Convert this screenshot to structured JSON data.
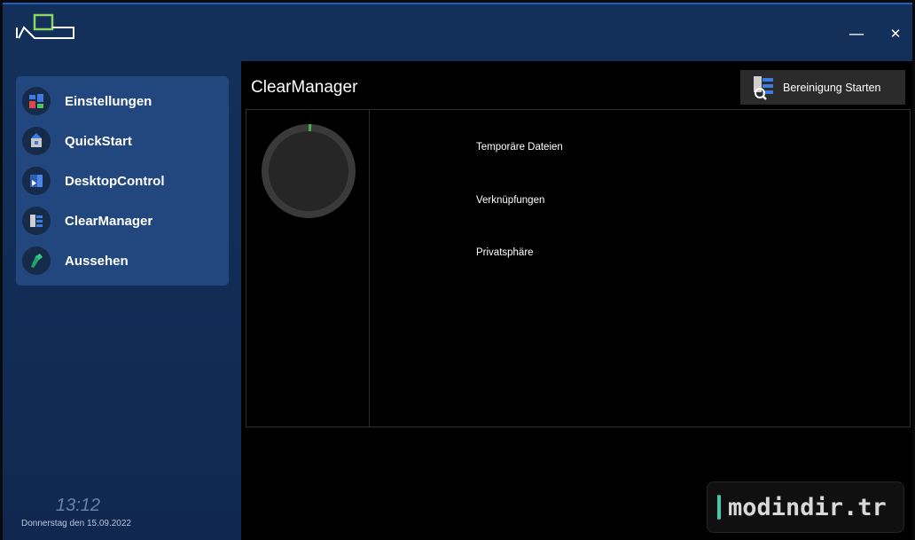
{
  "window": {
    "minimize_glyph": "—",
    "close_glyph": "✕"
  },
  "sidebar": {
    "items": [
      {
        "label": "Einstellungen",
        "icon": "settings-icon"
      },
      {
        "label": "QuickStart",
        "icon": "quickstart-icon"
      },
      {
        "label": "DesktopControl",
        "icon": "desktop-control-icon"
      },
      {
        "label": "ClearManager",
        "icon": "clear-manager-icon"
      },
      {
        "label": "Aussehen",
        "icon": "appearance-icon"
      }
    ],
    "time": "13:12",
    "date": "Donnerstag den 15.09.2022"
  },
  "main": {
    "title": "ClearManager",
    "start_button": {
      "label": "Bereinigung Starten",
      "icon": "cleanup-search-icon"
    },
    "categories": [
      "Temporäre Dateien",
      "Verknüpfungen",
      "Privatsphäre"
    ],
    "progress": 0.01
  },
  "watermark": {
    "text": "modindir.tr"
  },
  "colors": {
    "accent_green": "#8dd35f",
    "sidebar_panel": "#22477f",
    "progress_green": "#4caf50"
  }
}
